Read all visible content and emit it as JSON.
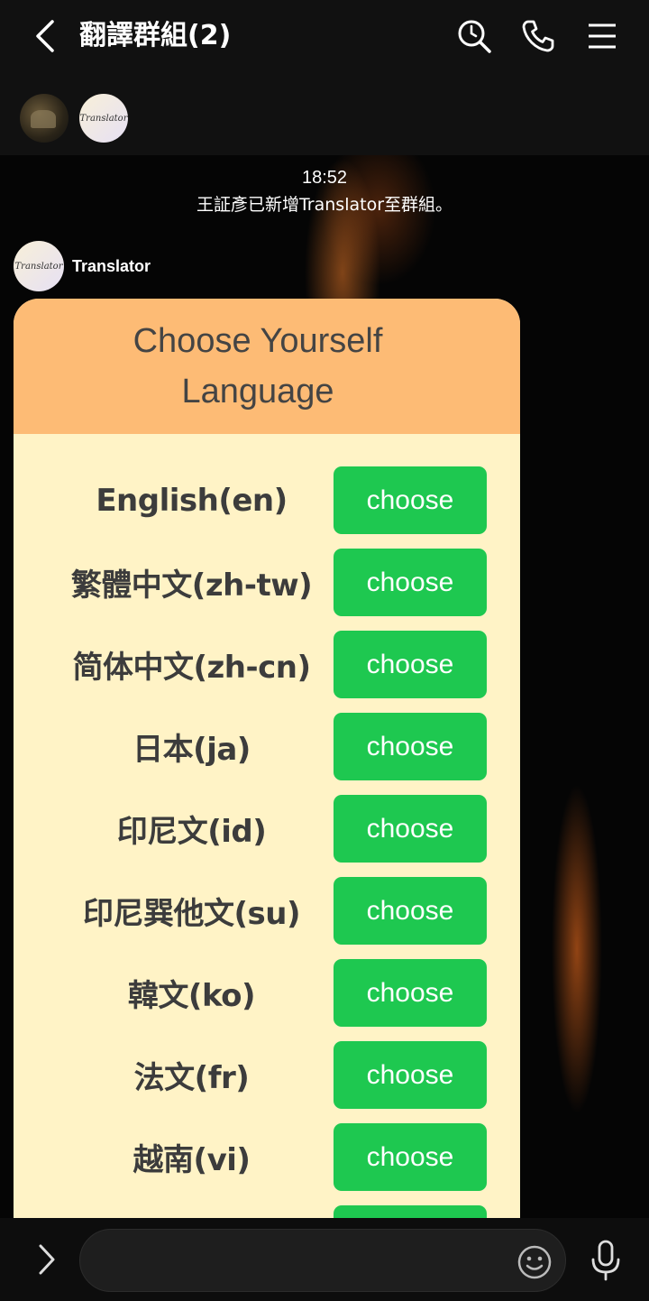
{
  "header": {
    "title": "翻譯群組(2)",
    "icons": [
      "back-icon",
      "search-history-icon",
      "phone-icon",
      "menu-icon"
    ]
  },
  "members": [
    {
      "name": "photo-avatar"
    },
    {
      "name": "translator-avatar",
      "avatar_text": "Translator"
    }
  ],
  "chat": {
    "time": "18:52",
    "system_message": "王証彥已新增Translator至群組。",
    "sender": {
      "name": "Translator",
      "avatar_text": "Translator"
    },
    "card": {
      "title": "Choose Yourself Language",
      "header_color": "#fdbb75",
      "body_color": "#fff3c6",
      "button_color": "#1ec850",
      "languages": [
        {
          "label": "English(en)",
          "button": "choose"
        },
        {
          "label": "繁體中文(zh-tw)",
          "button": "choose"
        },
        {
          "label": "简体中文(zh-cn)",
          "button": "choose"
        },
        {
          "label": "日本(ja)",
          "button": "choose"
        },
        {
          "label": "印尼文(id)",
          "button": "choose"
        },
        {
          "label": "印尼巽他文(su)",
          "button": "choose"
        },
        {
          "label": "韓文(ko)",
          "button": "choose"
        },
        {
          "label": "法文(fr)",
          "button": "choose"
        },
        {
          "label": "越南(vi)",
          "button": "choose"
        }
      ]
    }
  },
  "input_bar": {
    "placeholder": "",
    "icons": [
      "expand-icon",
      "emoji-icon",
      "microphone-icon"
    ]
  }
}
